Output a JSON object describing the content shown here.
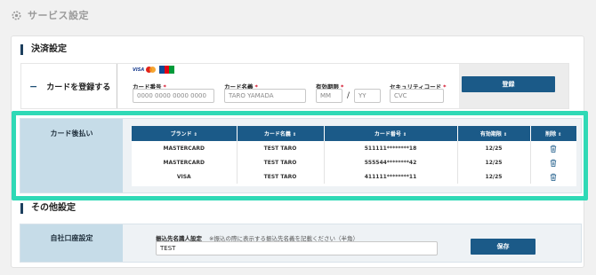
{
  "header": {
    "title": "サービス設定",
    "icon": "gear-icon"
  },
  "payment_section": {
    "title": "決済設定",
    "toggle_symbol": "−",
    "register_card_label": "カードを登録する",
    "brands": [
      "VISA",
      "Mastercard",
      "JCB"
    ],
    "card_number": {
      "label": "カード番号",
      "placeholder": "0000 0000 0000 0000"
    },
    "card_name": {
      "label": "カード名義",
      "placeholder": "TARO YAMADA"
    },
    "expiry": {
      "label": "有効期限",
      "month_placeholder": "MM",
      "separator": "/",
      "year_placeholder": "YY"
    },
    "security_code": {
      "label": "セキュリティコード",
      "placeholder": "CVC"
    },
    "required_mark": "*",
    "register_button": "登録"
  },
  "deferred_section": {
    "label": "カード後払い",
    "columns": [
      "ブランド",
      "カード名義",
      "カード番号",
      "有効期限",
      "削除"
    ],
    "sort_icon": "⇕",
    "rows": [
      {
        "brand": "MASTERCARD",
        "name": "TEST TARO",
        "number": "511111********18",
        "expiry": "12/25"
      },
      {
        "brand": "MASTERCARD",
        "name": "TEST TARO",
        "number": "555544********42",
        "expiry": "12/25"
      },
      {
        "brand": "VISA",
        "name": "TEST TARO",
        "number": "411111********11",
        "expiry": "12/25"
      }
    ]
  },
  "other_section": {
    "title": "その他設定",
    "bank_label": "自社口座設定",
    "transfer_name_label": "振込先名識人設定",
    "transfer_name_note": "※振込の際に表示する振込先名義を記載ください（半角）",
    "transfer_name_value": "TEST",
    "save_button": "保存"
  },
  "colors": {
    "primary": "#1b5a88",
    "highlight": "#2fd9b6",
    "label_bg": "#c6dce8",
    "required": "#d0021b"
  }
}
